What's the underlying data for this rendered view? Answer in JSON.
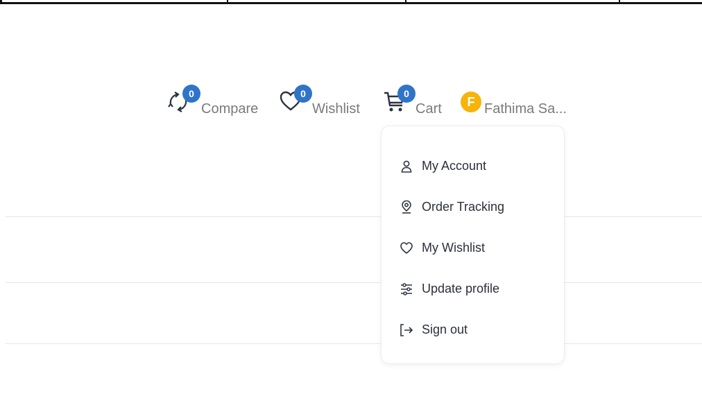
{
  "header": {
    "compare": {
      "label": "Compare",
      "count": "0",
      "icon": "compare-icon"
    },
    "wishlist": {
      "label": "Wishlist",
      "count": "0",
      "icon": "heart-icon"
    },
    "cart": {
      "label": "Cart",
      "count": "0",
      "icon": "cart-icon"
    },
    "user": {
      "initial": "F",
      "name": "Fathima Sa..."
    }
  },
  "dropdown": {
    "items": [
      {
        "label": "My Account",
        "icon": "user-icon"
      },
      {
        "label": "Order Tracking",
        "icon": "location-icon"
      },
      {
        "label": "My Wishlist",
        "icon": "heart-icon"
      },
      {
        "label": "Update profile",
        "icon": "sliders-icon"
      },
      {
        "label": "Sign out",
        "icon": "sign-out-icon"
      }
    ]
  },
  "colors": {
    "badge": "#2f74c8",
    "avatar": "#f6b40a",
    "text_muted": "#7a7a7a",
    "menu_text": "#2b2f3a"
  }
}
